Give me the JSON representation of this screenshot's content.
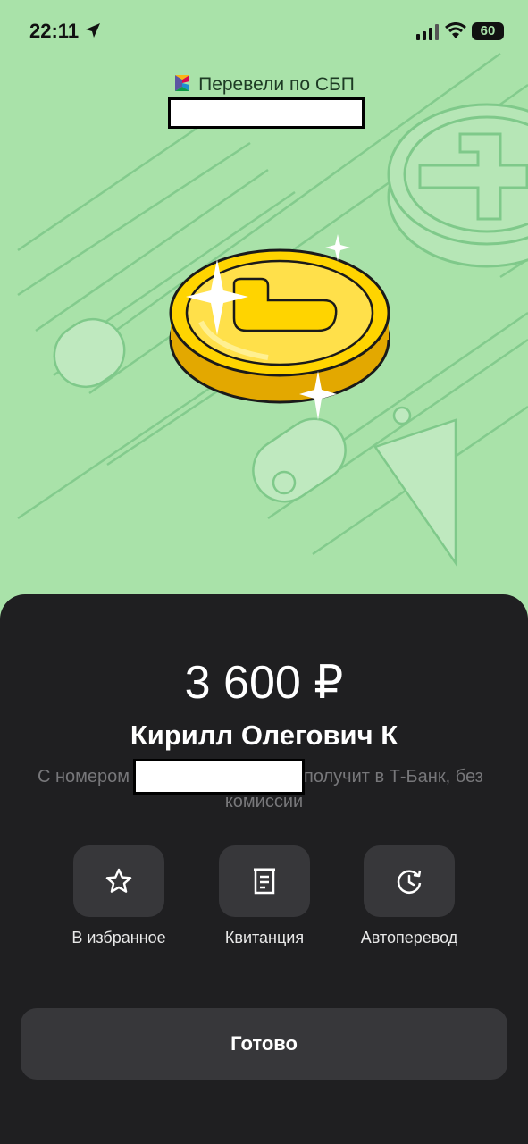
{
  "status_bar": {
    "time": "22:11",
    "battery": "60"
  },
  "header": {
    "title": "Перевели по СБП"
  },
  "transfer": {
    "amount": "3 600 ₽",
    "recipient": "Кирилл Олегович К",
    "note_prefix": "С номером",
    "note_suffix": "получит в Т-Банк, без",
    "note_line2": "комиссии"
  },
  "actions": [
    {
      "label": "В избранное",
      "icon": "star-icon"
    },
    {
      "label": "Квитанция",
      "icon": "receipt-icon"
    },
    {
      "label": "Автоперевод",
      "icon": "auto-transfer-icon"
    }
  ],
  "done_button": {
    "label": "Готово"
  },
  "colors": {
    "hero_bg": "#a9e2a9",
    "sheet_bg": "#1f1f21",
    "button_bg": "#37373a",
    "coin": "#ffd400"
  }
}
